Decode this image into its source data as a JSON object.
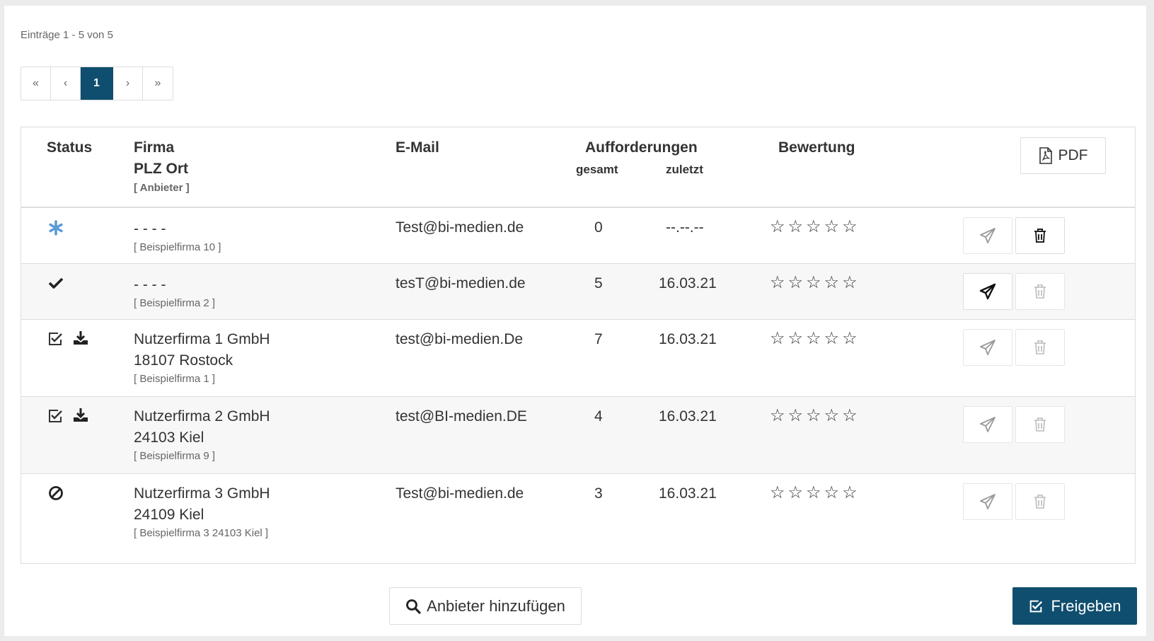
{
  "entries_info": "Einträge 1 - 5 von 5",
  "pagination": {
    "first": "«",
    "prev": "‹",
    "current": "1",
    "next": "›",
    "last": "»"
  },
  "table": {
    "headers": {
      "status": "Status",
      "firma": "Firma",
      "plz_ort": "PLZ Ort",
      "anbieter": "[ Anbieter ]",
      "email": "E-Mail",
      "aufforderungen": "Aufforderungen",
      "gesamt": "gesamt",
      "zuletzt": "zuletzt",
      "bewertung": "Bewertung",
      "pdf": "PDF"
    },
    "rows": [
      {
        "status_icon": "asterisk-icon",
        "firma": "- - - -",
        "ort": "",
        "anbieter": "[ Beispielfirma 10 ]",
        "email": "Test@bi-medien.de",
        "gesamt": "0",
        "zuletzt": "--.--.--",
        "stars": "☆☆☆☆☆"
      },
      {
        "status_icon": "check-icon",
        "firma": "- - - -",
        "ort": "",
        "anbieter": "[ Beispielfirma 2 ]",
        "email": "tesT@bi-medien.de",
        "gesamt": "5",
        "zuletzt": "16.03.21",
        "stars": "☆☆☆☆☆"
      },
      {
        "status_icon": "checkbox-checked-icon",
        "firma": "Nutzerfirma 1 GmbH",
        "ort": "18107 Rostock",
        "anbieter": "[ Beispielfirma 1 ]",
        "email": "test@bi-medien.De",
        "gesamt": "7",
        "zuletzt": "16.03.21",
        "stars": "☆☆☆☆☆"
      },
      {
        "status_icon": "checkbox-checked-icon",
        "firma": "Nutzerfirma 2 GmbH",
        "ort": "24103 Kiel",
        "anbieter": "[ Beispielfirma 9 ]",
        "email": "test@BI-medien.DE",
        "gesamt": "4",
        "zuletzt": "16.03.21",
        "stars": "☆☆☆☆☆"
      },
      {
        "status_icon": "ban-icon",
        "firma": "Nutzerfirma 3 GmbH",
        "ort": "24109 Kiel",
        "anbieter": "[ Beispielfirma 3 24103 Kiel ]",
        "email": "Test@bi-medien.de",
        "gesamt": "3",
        "zuletzt": "16.03.21",
        "stars": "☆☆☆☆☆"
      }
    ]
  },
  "buttons": {
    "add_provider": "Anbieter hinzufügen",
    "approve": "Freigeben"
  },
  "colors": {
    "primary": "#0f4e6e",
    "asterisk": "#5b9bd5",
    "border": "#dddddd"
  }
}
